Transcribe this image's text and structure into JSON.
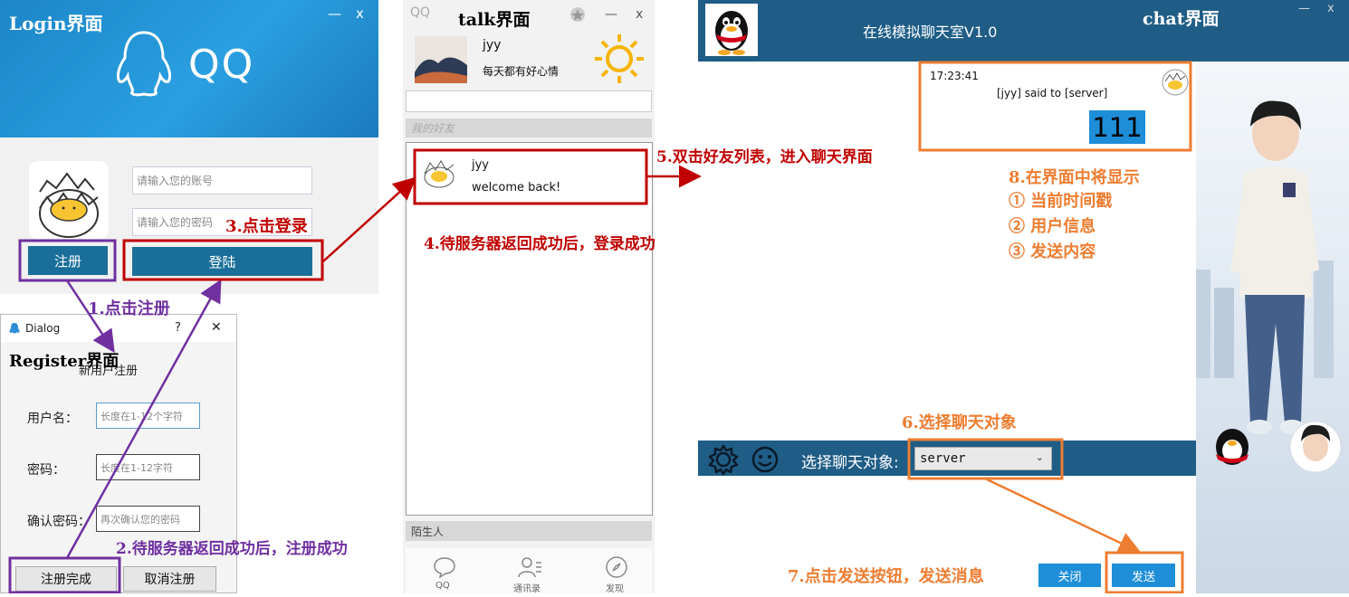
{
  "login": {
    "title": "Login界面",
    "minimize": "—",
    "close": "x",
    "logo_text": "QQ",
    "account_placeholder": "请输入您的账号",
    "password_placeholder": "请输入您的密码",
    "register_button": "注册",
    "login_button": "登陆"
  },
  "talk": {
    "title": "talk界面",
    "logo_text": "QQ",
    "minimize": "—",
    "close": "x",
    "user_name": "jyy",
    "signature": "每天都有好心情",
    "group_friends": "我的好友",
    "friends": [
      {
        "name": "jyy",
        "message": "welcome back!"
      }
    ],
    "group_strangers": "陌生人",
    "tabs": [
      {
        "label": "QQ"
      },
      {
        "label": "通讯录"
      },
      {
        "label": "发现"
      }
    ]
  },
  "register": {
    "window_title": "Dialog",
    "help": "?",
    "close": "✕",
    "caption": "Register界面",
    "heading": "新用户注册",
    "username_label": "用户名：",
    "username_placeholder": "长度在1-12个字符",
    "password_label": "密码：",
    "password_placeholder": "长度在1-12字符",
    "confirm_label": "确认密码：",
    "confirm_placeholder": "再次确认您的密码",
    "done_button": "注册完成",
    "cancel_button": "取消注册"
  },
  "chat": {
    "caption": "chat界面",
    "title": "在线模拟聊天室V1.0",
    "minimize": "—",
    "close": "x",
    "message": {
      "time": "17:23:41",
      "header": "[jyy] said to [server]",
      "content": "111"
    },
    "target_label": "选择聊天对象:",
    "target_value": "server",
    "close_button": "关闭",
    "send_button": "发送"
  },
  "annotations": {
    "step1": "1.点击注册",
    "step2": "2.待服务器返回成功后，注册成功",
    "step3": "3.点击登录",
    "step4": "4.待服务器返回成功后，登录成功",
    "step5": "5.双击好友列表，进入聊天界面",
    "step6": "6.选择聊天对象",
    "step7": "7.点击发送按钮，发送消息",
    "step8_title": "8.在界面中将显示",
    "step8_items": [
      "① 当前时间戳",
      "② 用户信息",
      "③ 发送内容"
    ]
  },
  "colors": {
    "purple": "#7030a0",
    "red": "#c00000",
    "orange": "#ed7d31",
    "chat_blue": "#1f5d86",
    "login_blue": "#1a6f9a",
    "send_blue": "#1e8ed8"
  }
}
